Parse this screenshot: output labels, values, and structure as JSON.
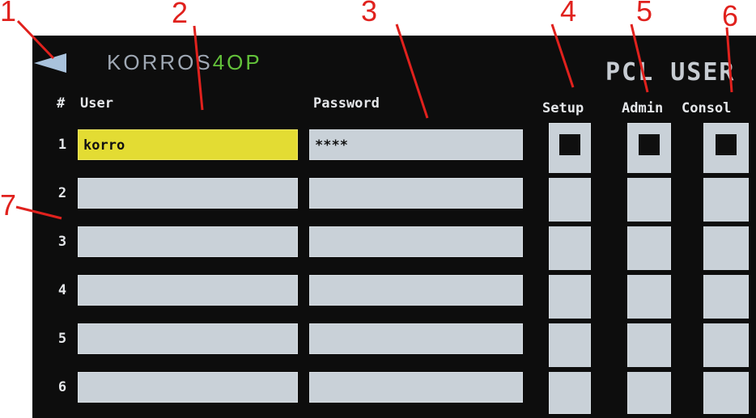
{
  "app": {
    "logo_main": "KORROS",
    "logo_accent": "4OP",
    "logo_suffix": "",
    "title": "PCL USER"
  },
  "table": {
    "headers": {
      "num": "#",
      "user": "User",
      "password": "Password",
      "setup": "Setup",
      "admin": "Admin",
      "console": "Consol"
    },
    "rows": [
      {
        "num": "1",
        "user": "korro",
        "password": "****",
        "setup": true,
        "admin": true,
        "console": true
      },
      {
        "num": "2",
        "user": "",
        "password": "",
        "setup": false,
        "admin": false,
        "console": false
      },
      {
        "num": "3",
        "user": "",
        "password": "",
        "setup": false,
        "admin": false,
        "console": false
      },
      {
        "num": "4",
        "user": "",
        "password": "",
        "setup": false,
        "admin": false,
        "console": false
      },
      {
        "num": "5",
        "user": "",
        "password": "",
        "setup": false,
        "admin": false,
        "console": false
      },
      {
        "num": "6",
        "user": "",
        "password": "",
        "setup": false,
        "admin": false,
        "console": false
      }
    ]
  },
  "callouts": [
    "1",
    "2",
    "3",
    "4",
    "5",
    "6",
    "7"
  ],
  "colors": {
    "callout": "#e0211d",
    "active_field": "#e3dc33",
    "field": "#c9d1d8",
    "logo_accent": "#63c23a"
  },
  "icons": {
    "back": "triangle-left-icon"
  }
}
